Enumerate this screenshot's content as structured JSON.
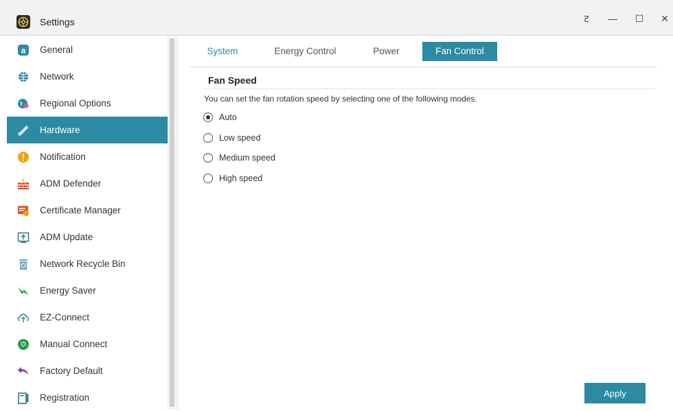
{
  "window": {
    "title": "Settings",
    "controls": {
      "pin": "ट",
      "minimize": "—",
      "maximize": "☐",
      "close": "✕"
    }
  },
  "sidebar": {
    "items": [
      {
        "label": "General",
        "icon": "general-icon",
        "color": "#2d8aa3"
      },
      {
        "label": "Network",
        "icon": "globe-icon",
        "color": "#2d8aa3"
      },
      {
        "label": "Regional Options",
        "icon": "regional-icon",
        "color": "#2d8aa3"
      },
      {
        "label": "Hardware",
        "icon": "hardware-icon",
        "color": "#ffffff",
        "active": true
      },
      {
        "label": "Notification",
        "icon": "notification-icon",
        "color": "#f0a500"
      },
      {
        "label": "ADM Defender",
        "icon": "firewall-icon",
        "color": "#e05a2a"
      },
      {
        "label": "Certificate Manager",
        "icon": "certificate-icon",
        "color": "#e05a2a"
      },
      {
        "label": "ADM Update",
        "icon": "update-icon",
        "color": "#2d8aa3"
      },
      {
        "label": "Network Recycle Bin",
        "icon": "recycle-bin-icon",
        "color": "#6aa9b8"
      },
      {
        "label": "Energy Saver",
        "icon": "energy-icon",
        "color": "#2aa845"
      },
      {
        "label": "EZ-Connect",
        "icon": "cloud-icon",
        "color": "#2d8aa3"
      },
      {
        "label": "Manual Connect",
        "icon": "manual-connect-icon",
        "color": "#2aa845"
      },
      {
        "label": "Factory Default",
        "icon": "undo-icon",
        "color": "#8a3aa8"
      },
      {
        "label": "Registration",
        "icon": "registration-icon",
        "color": "#2d8aa3"
      }
    ]
  },
  "tabs": [
    {
      "label": "System"
    },
    {
      "label": "Energy Control"
    },
    {
      "label": "Power"
    },
    {
      "label": "Fan Control",
      "active": true
    }
  ],
  "fan": {
    "section_title": "Fan Speed",
    "description": "You can set the fan rotation speed by selecting one of the following modes.",
    "options": [
      {
        "label": "Auto",
        "checked": true
      },
      {
        "label": "Low speed",
        "checked": false
      },
      {
        "label": "Medium speed",
        "checked": false
      },
      {
        "label": "High speed",
        "checked": false
      }
    ]
  },
  "apply_label": "Apply",
  "colors": {
    "accent": "#2d8aa3"
  }
}
